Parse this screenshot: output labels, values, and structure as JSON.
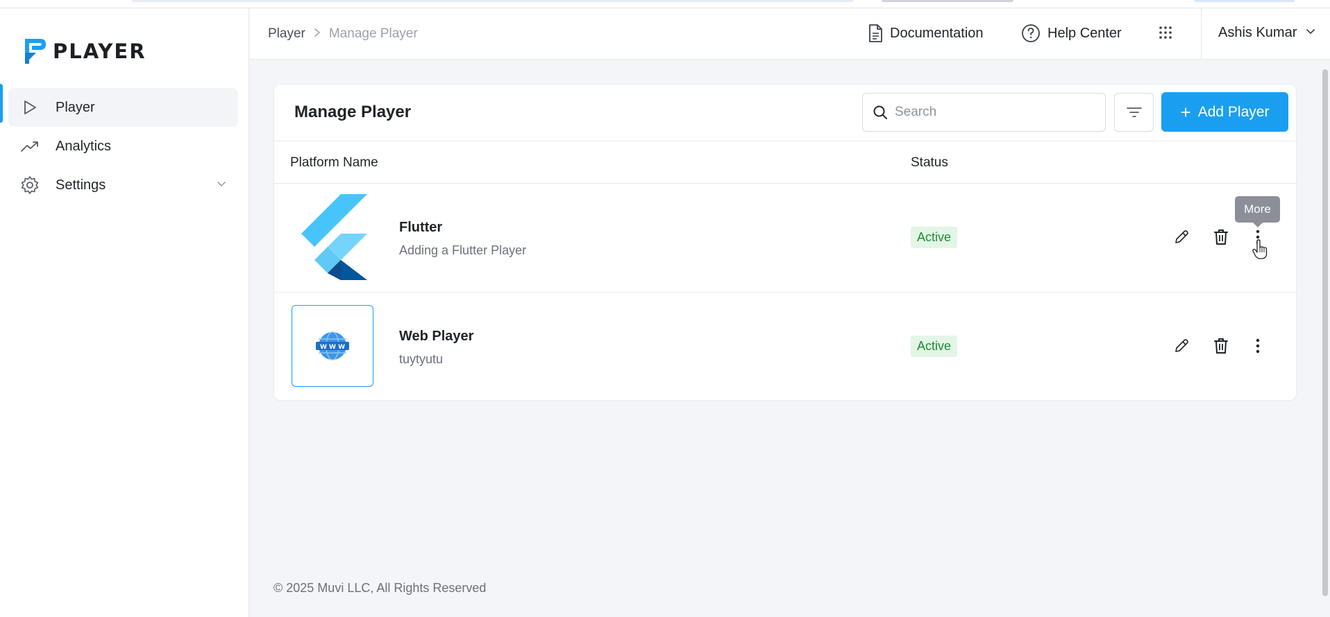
{
  "brand": {
    "name": "PLAYER",
    "accent": "#1a9ff0"
  },
  "sidebar": {
    "items": [
      {
        "label": "Player",
        "icon": "play-icon",
        "active": true
      },
      {
        "label": "Analytics",
        "icon": "trending-up-icon",
        "active": false
      },
      {
        "label": "Settings",
        "icon": "gear-icon",
        "active": false,
        "expandable": true
      }
    ]
  },
  "header": {
    "breadcrumb": {
      "root": "Player",
      "current": "Manage Player"
    },
    "documentation": "Documentation",
    "help_center": "Help Center",
    "user_name": "Ashis Kumar"
  },
  "main": {
    "title": "Manage Player",
    "search": {
      "placeholder": "Search",
      "value": ""
    },
    "add_button": "Add Player",
    "columns": {
      "platform_name": "Platform Name",
      "status": "Status"
    },
    "rows": [
      {
        "name": "Flutter",
        "description": "Adding a Flutter Player",
        "status": "Active",
        "icon": "flutter-logo"
      },
      {
        "name": "Web Player",
        "description": "tuytyutu",
        "status": "Active",
        "icon": "www-globe-icon"
      }
    ],
    "tooltip": "More"
  },
  "footer": {
    "copyright": "© 2025 Muvi LLC, All Rights Reserved"
  }
}
